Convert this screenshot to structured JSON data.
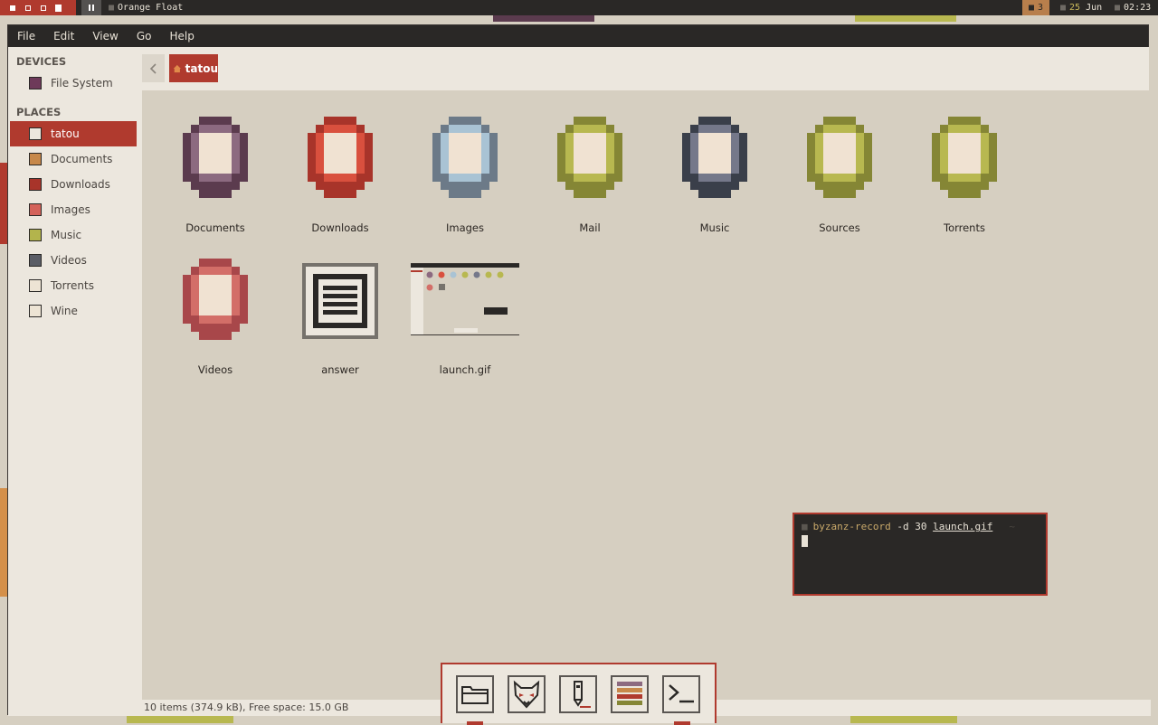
{
  "topbar": {
    "window_title": "Orange Float",
    "notification_count": "3",
    "date_day": "25",
    "date_month": "Jun",
    "time": "02:23"
  },
  "menubar": {
    "items": [
      "File",
      "Edit",
      "View",
      "Go",
      "Help"
    ]
  },
  "sidebar": {
    "devices_heading": "DEVICES",
    "places_heading": "PLACES",
    "devices": [
      {
        "label": "File System",
        "color": "#6e3a5a"
      }
    ],
    "places": [
      {
        "label": "tatou",
        "color": "#ece7de"
      },
      {
        "label": "Documents",
        "color": "#c7884a"
      },
      {
        "label": "Downloads",
        "color": "#a8342a"
      },
      {
        "label": "Images",
        "color": "#d4625a"
      },
      {
        "label": "Music",
        "color": "#b3b44c"
      },
      {
        "label": "Videos",
        "color": "#5a5d66"
      },
      {
        "label": "Torrents",
        "color": "#ede4d4"
      },
      {
        "label": "Wine",
        "color": "#ede4d4"
      }
    ]
  },
  "pathbar": {
    "current": "tatou"
  },
  "files": [
    {
      "label": "Documents",
      "kind": "folder",
      "outer": "#5b3b4e",
      "inner": "#8c6a80"
    },
    {
      "label": "Downloads",
      "kind": "folder",
      "outer": "#a8342a",
      "inner": "#d9503e"
    },
    {
      "label": "Images",
      "kind": "folder",
      "outer": "#6c7a88",
      "inner": "#a9c3d4"
    },
    {
      "label": "Mail",
      "kind": "folder",
      "outer": "#858635",
      "inner": "#b8b850"
    },
    {
      "label": "Music",
      "kind": "folder",
      "outer": "#3a3f4a",
      "inner": "#75788a"
    },
    {
      "label": "Sources",
      "kind": "folder",
      "outer": "#858635",
      "inner": "#b8b850"
    },
    {
      "label": "Torrents",
      "kind": "folder",
      "outer": "#858635",
      "inner": "#b8b850"
    },
    {
      "label": "Videos",
      "kind": "folder",
      "outer": "#a8474a",
      "inner": "#d36e68"
    },
    {
      "label": "answer",
      "kind": "text"
    },
    {
      "label": "launch.gif",
      "kind": "image"
    }
  ],
  "statusbar": {
    "text": "10 items (374.9 kB), Free space: 15.0 GB"
  },
  "terminal": {
    "command": "byzanz-record",
    "args": "-d 30",
    "file": "launch.gif",
    "cwd": "~"
  },
  "dock": {
    "items": [
      {
        "icon": "folder-icon"
      },
      {
        "icon": "fox-browser-icon"
      },
      {
        "icon": "text-editor-icon"
      },
      {
        "icon": "library-books-icon"
      },
      {
        "icon": "terminal-icon"
      }
    ]
  }
}
